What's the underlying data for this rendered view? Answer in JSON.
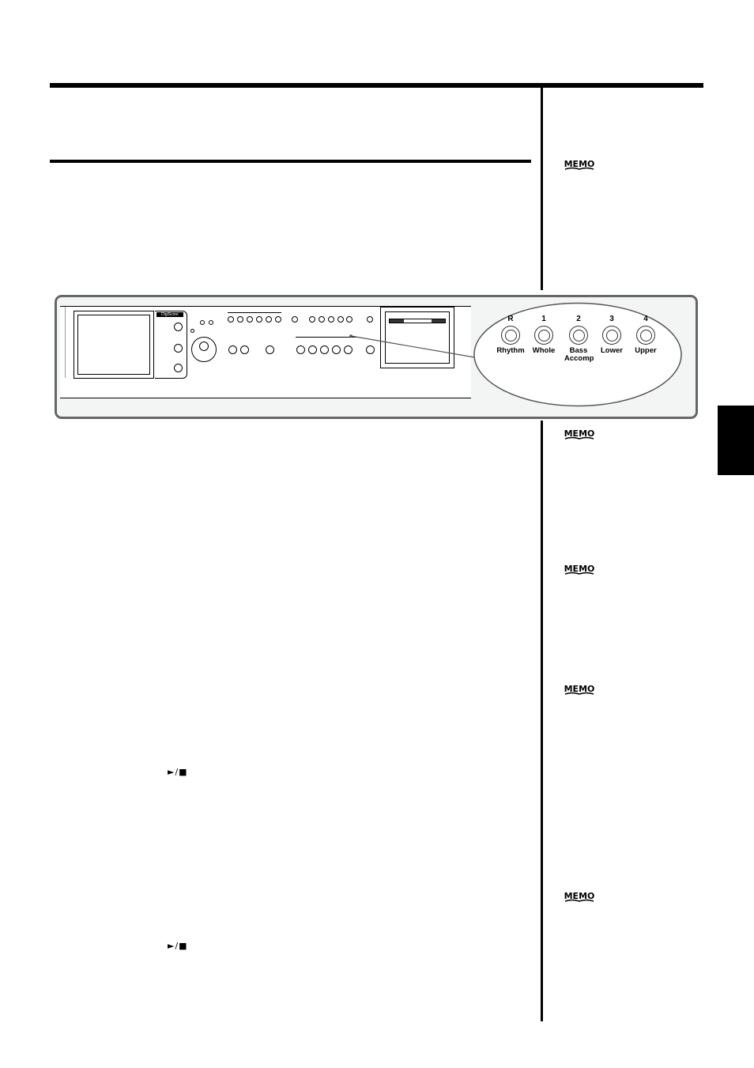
{
  "page": {
    "side_tab_color": "#000000",
    "panel_background": "#f3f4f4",
    "panel_border": "#666666"
  },
  "sidebar": {
    "memos": [
      {
        "label": "MEMO",
        "icon": "memo-book-icon"
      },
      {
        "label": "MEMO",
        "icon": "memo-book-icon"
      },
      {
        "label": "MEMO",
        "icon": "memo-book-icon"
      },
      {
        "label": "MEMO",
        "icon": "memo-book-icon"
      },
      {
        "label": "MEMO",
        "icon": "memo-book-icon"
      }
    ]
  },
  "body": {
    "transport_symbols": [
      {
        "text": "►/■",
        "icon": "play-stop-icon"
      },
      {
        "text": "►/■",
        "icon": "play-stop-icon"
      }
    ]
  },
  "panel": {
    "digiscore_label": "DigiScore",
    "callout": {
      "channels": [
        {
          "number": "R",
          "label": "Rhythm"
        },
        {
          "number": "1",
          "label": "Whole"
        },
        {
          "number": "2",
          "label": "Bass Accomp"
        },
        {
          "number": "3",
          "label": "Lower"
        },
        {
          "number": "4",
          "label": "Upper"
        }
      ]
    }
  }
}
